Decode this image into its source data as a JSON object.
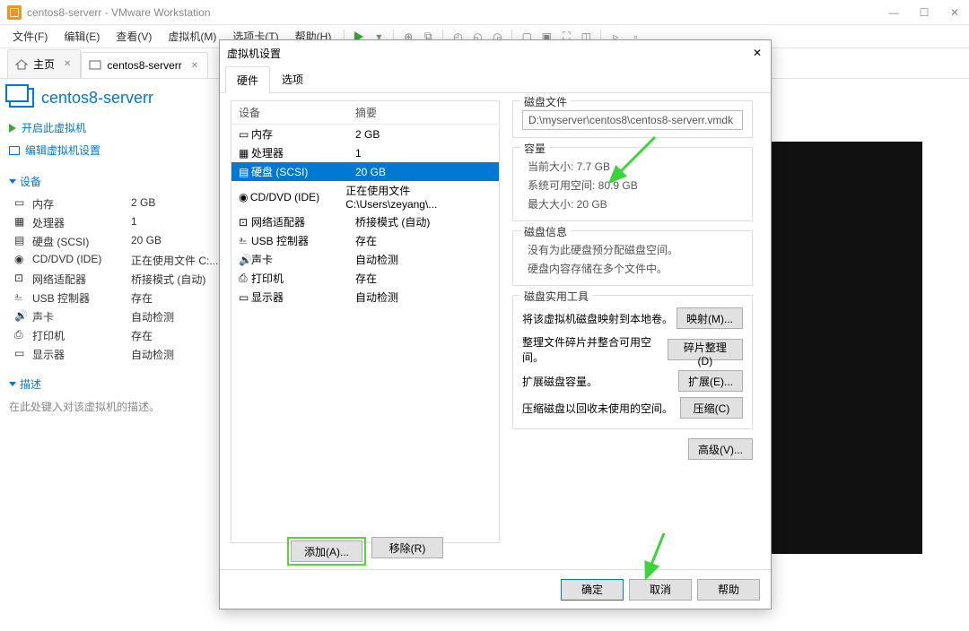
{
  "window": {
    "title": "centos8-serverr - VMware Workstation"
  },
  "menu": {
    "file": "文件(F)",
    "edit": "编辑(E)",
    "view": "查看(V)",
    "vm": "虚拟机(M)",
    "tabs": "选项卡(T)",
    "help": "帮助(H)"
  },
  "tabs": {
    "home": "主页",
    "vm": "centos8-serverr"
  },
  "left": {
    "title": "centos8-serverr",
    "power_on": "开启此虚拟机",
    "edit_settings": "编辑虚拟机设置",
    "devices_header": "设备",
    "desc_header": "描述",
    "desc_placeholder": "在此处键入对该虚拟机的描述。",
    "rows": [
      {
        "name": "内存",
        "value": "2 GB"
      },
      {
        "name": "处理器",
        "value": "1"
      },
      {
        "name": "硬盘 (SCSI)",
        "value": "20 GB"
      },
      {
        "name": "CD/DVD (IDE)",
        "value": "正在使用文件 C:..."
      },
      {
        "name": "网络适配器",
        "value": "桥接模式 (自动)"
      },
      {
        "name": "USB 控制器",
        "value": "存在"
      },
      {
        "name": "声卡",
        "value": "自动检测"
      },
      {
        "name": "打印机",
        "value": "存在"
      },
      {
        "name": "显示器",
        "value": "自动检测"
      }
    ]
  },
  "dialog": {
    "title": "虚拟机设置",
    "tab_hardware": "硬件",
    "tab_options": "选项",
    "col_device": "设备",
    "col_summary": "摘要",
    "rows": [
      {
        "name": "内存",
        "summary": "2 GB"
      },
      {
        "name": "处理器",
        "summary": "1"
      },
      {
        "name": "硬盘 (SCSI)",
        "summary": "20 GB"
      },
      {
        "name": "CD/DVD (IDE)",
        "summary": "正在使用文件 C:\\Users\\zeyang\\..."
      },
      {
        "name": "网络适配器",
        "summary": "桥接模式 (自动)"
      },
      {
        "name": "USB 控制器",
        "summary": "存在"
      },
      {
        "name": "声卡",
        "summary": "自动检测"
      },
      {
        "name": "打印机",
        "summary": "存在"
      },
      {
        "name": "显示器",
        "summary": "自动检测"
      }
    ],
    "selected_index": 2,
    "disk_file_label": "磁盘文件",
    "disk_file_path": "D:\\myserver\\centos8\\centos8-serverr.vmdk",
    "capacity_label": "容量",
    "current_size": "当前大小: 7.7 GB",
    "free_space": "系统可用空间: 80.9 GB",
    "max_size": "最大大小: 20 GB",
    "disk_info_label": "磁盘信息",
    "disk_info_1": "没有为此硬盘预分配磁盘空间。",
    "disk_info_2": "硬盘内容存储在多个文件中。",
    "util_label": "磁盘实用工具",
    "util_map_text": "将该虚拟机磁盘映射到本地卷。",
    "util_map_btn": "映射(M)...",
    "util_defrag_text": "整理文件碎片并整合可用空间。",
    "util_defrag_btn": "碎片整理(D)",
    "util_expand_text": "扩展磁盘容量。",
    "util_expand_btn": "扩展(E)...",
    "util_compact_text": "压缩磁盘以回收未使用的空间。",
    "util_compact_btn": "压缩(C)",
    "advanced_btn": "高级(V)...",
    "add_btn": "添加(A)...",
    "remove_btn": "移除(R)",
    "ok_btn": "确定",
    "cancel_btn": "取消",
    "help_btn": "帮助"
  }
}
